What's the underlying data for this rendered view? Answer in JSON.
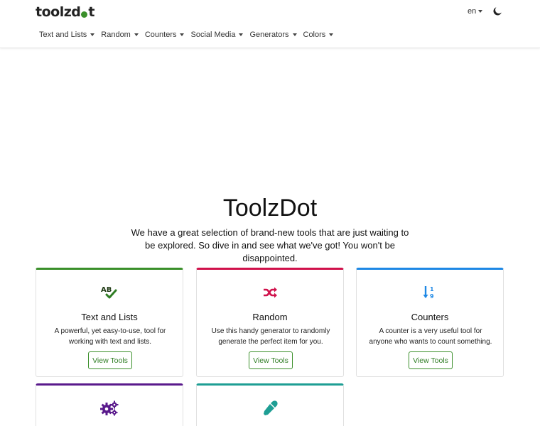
{
  "header": {
    "logo_before": "toolzd",
    "logo_after": "t",
    "language": "en"
  },
  "nav": [
    {
      "label": "Text and Lists"
    },
    {
      "label": "Random"
    },
    {
      "label": "Counters"
    },
    {
      "label": "Social Media"
    },
    {
      "label": "Generators"
    },
    {
      "label": "Colors"
    }
  ],
  "hero": {
    "title": "ToolzDot",
    "text": "We have a great selection of brand-new tools that are just waiting to be explored. So dive in and see what we've got! You won't be disappointed."
  },
  "cards": [
    {
      "title": "Text and Lists",
      "desc": "A powerful, yet easy-to-use, tool for working with text and lists.",
      "button": "View Tools",
      "icon": "spellcheck-icon",
      "color": "#3a8f2a"
    },
    {
      "title": "Random",
      "desc": "Use this handy generator to randomly generate the perfect item for you.",
      "button": "View Tools",
      "icon": "shuffle-icon",
      "color": "#d0114b"
    },
    {
      "title": "Counters",
      "desc": "A counter is a very useful tool for anyone who wants to count something.",
      "button": "View Tools",
      "icon": "sort-numeric-icon",
      "color": "#1e88e5"
    },
    {
      "title": "",
      "desc": "",
      "button": "",
      "icon": "gears-icon",
      "color": "#5a1a8c"
    },
    {
      "title": "",
      "desc": "",
      "button": "",
      "icon": "eyedropper-icon",
      "color": "#1e9e94"
    }
  ],
  "colors": {
    "accent": "#3a8f2a"
  }
}
